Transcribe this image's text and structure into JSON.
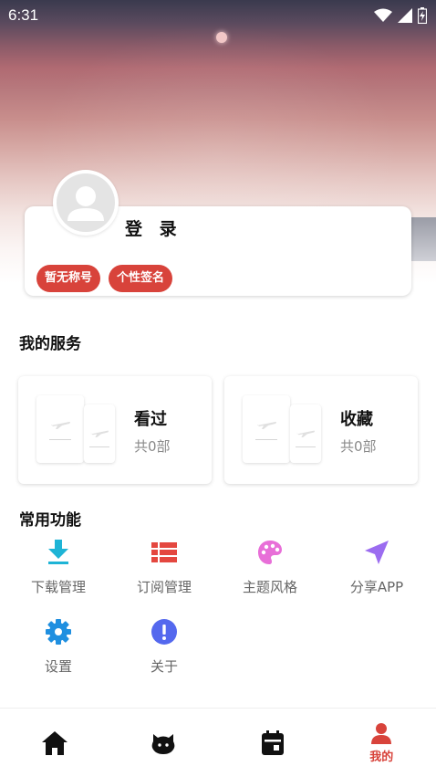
{
  "status_bar": {
    "time": "6:31",
    "icons": [
      "wifi-icon",
      "cell-signal-icon",
      "battery-icon"
    ]
  },
  "profile": {
    "login_label": "登 录",
    "tags": [
      "暂无称号",
      "个性签名"
    ],
    "avatar_icon": "default-user-avatar-icon"
  },
  "services": {
    "title": "我的服务",
    "cards": [
      {
        "label": "看过",
        "count": "共0部"
      },
      {
        "label": "收藏",
        "count": "共0部"
      }
    ]
  },
  "common": {
    "title": "常用功能",
    "items": [
      {
        "label": "下载管理",
        "icon": "download-icon",
        "color": "#1eb4d6"
      },
      {
        "label": "订阅管理",
        "icon": "list-icon",
        "color": "#e4473f"
      },
      {
        "label": "主题风格",
        "icon": "palette-icon",
        "color": "#e86fd8"
      },
      {
        "label": "分享APP",
        "icon": "send-icon",
        "color": "#9b6cf0"
      },
      {
        "label": "设置",
        "icon": "gear-icon",
        "color": "#1f8fe0"
      },
      {
        "label": "关于",
        "icon": "info-icon",
        "color": "#5468ee"
      }
    ]
  },
  "bottom_nav": {
    "items": [
      {
        "icon": "home-icon",
        "label": ""
      },
      {
        "icon": "cat-face-icon",
        "label": ""
      },
      {
        "icon": "calendar-icon",
        "label": ""
      },
      {
        "icon": "person-icon",
        "label": "我的",
        "active": true
      }
    ]
  },
  "colors": {
    "accent": "#d8433b",
    "muted_text": "#666666"
  }
}
